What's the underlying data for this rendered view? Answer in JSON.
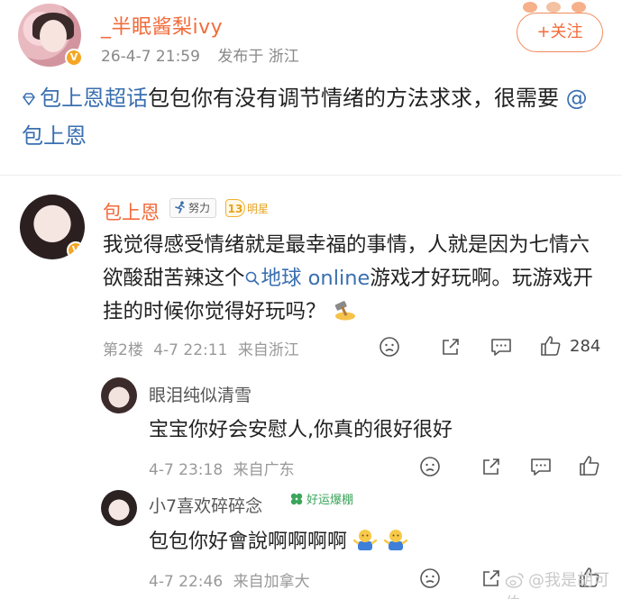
{
  "post": {
    "username": "_半眠酱梨ivy",
    "timestamp": "26-4-7 21:59",
    "location": "发布于 浙江",
    "follow_label": "+关注",
    "supertopic_link": "包上恩超话",
    "text_body": "包包你有没有调节情绪的方法求求，很需要",
    "mention": "@包上恩"
  },
  "comment": {
    "username": "包上恩",
    "effort_badge": "努力",
    "star_level": "13",
    "star_label": "明星",
    "text_before_link": "我觉得感受情绪就是最幸福的事情，人就是因为七情六欲酸甜苦辣这个",
    "search_link": "地球 online",
    "text_after_link": "游戏才好玩啊。玩游戏开挂的时候你觉得好玩吗？",
    "floor": "第2楼",
    "time": "4-7 22:11",
    "location": "来自浙江",
    "like_count": "284"
  },
  "replies": [
    {
      "username": "眼泪纯似清雪",
      "text": "宝宝你好会安慰人,你真的很好很好",
      "time": "4-7 23:18",
      "location": "来自广东"
    },
    {
      "username": "小7喜欢碎碎念",
      "badge": "好运爆棚",
      "text": "包包你好會說啊啊啊啊",
      "time": "4-7 22:46",
      "location": "来自加拿大"
    }
  ],
  "watermark": "@我是胡可伯",
  "colors": {
    "username_accent": "#f26b3a",
    "link_blue": "#3a6fb0",
    "meta_gray": "#999999",
    "badge_gold": "#f5a623",
    "badge_green": "#3aa55a"
  },
  "icons": [
    "diamond-icon",
    "verified-badge-icon",
    "runner-icon",
    "search-icon",
    "hammer-emoji-icon",
    "dislike-icon",
    "share-icon",
    "comment-icon",
    "like-icon",
    "clover-icon",
    "shrug-emoji-icon",
    "weibo-logo-icon"
  ]
}
